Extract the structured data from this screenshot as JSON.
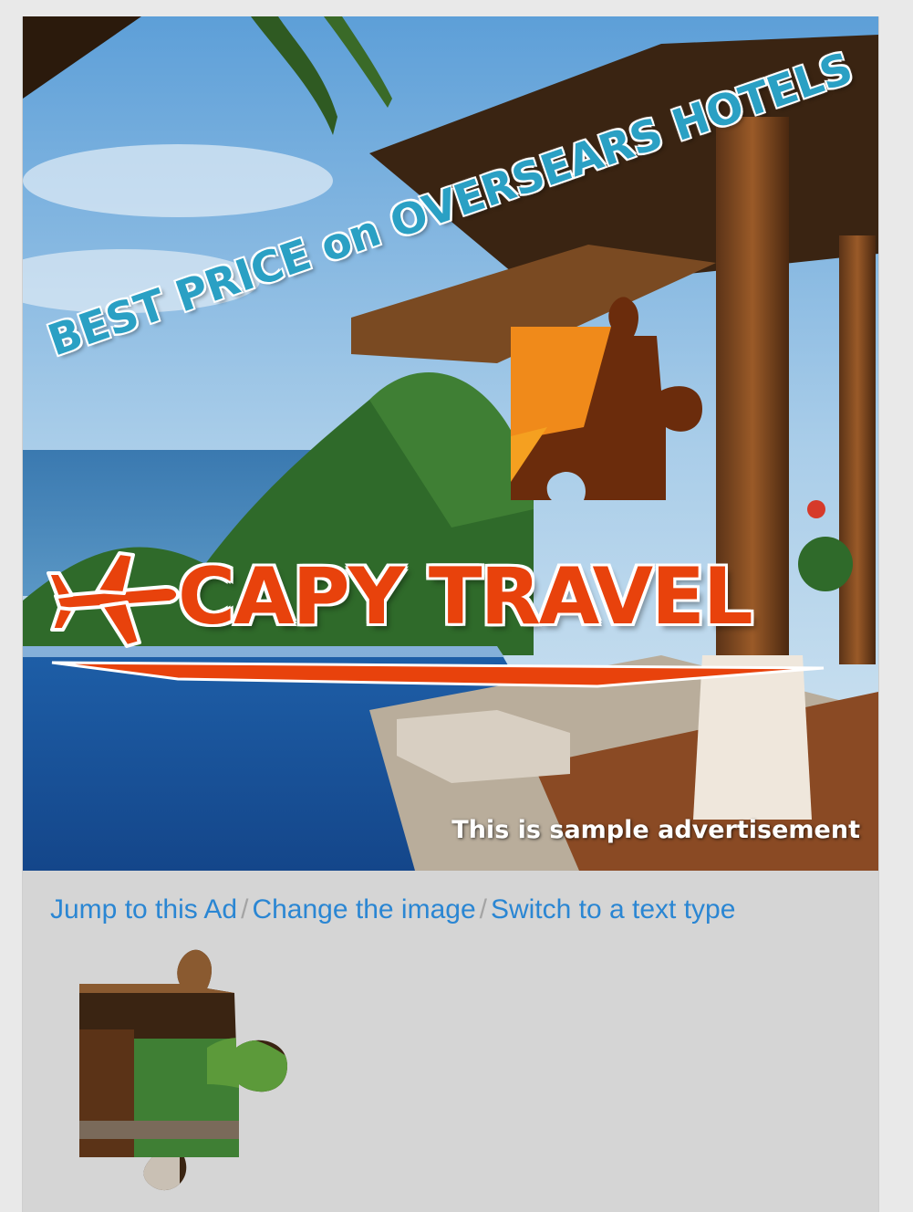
{
  "ad": {
    "headline": "BEST PRICE on OVERSEARS HOTELS",
    "brand": "CAPY TRAVEL",
    "caption": "This is sample advertisement",
    "brand_color": "#e8420c",
    "headline_color": "#2aa0c4",
    "logo_icon": "airplane-icon"
  },
  "links": {
    "jump": "Jump to this Ad",
    "separator_1": "/",
    "change_image": "Change the image",
    "separator_2": "/",
    "switch_text": "Switch to a text type",
    "link_color": "#2a86d3"
  },
  "puzzle": {
    "piece_icon": "puzzle-piece-icon"
  }
}
